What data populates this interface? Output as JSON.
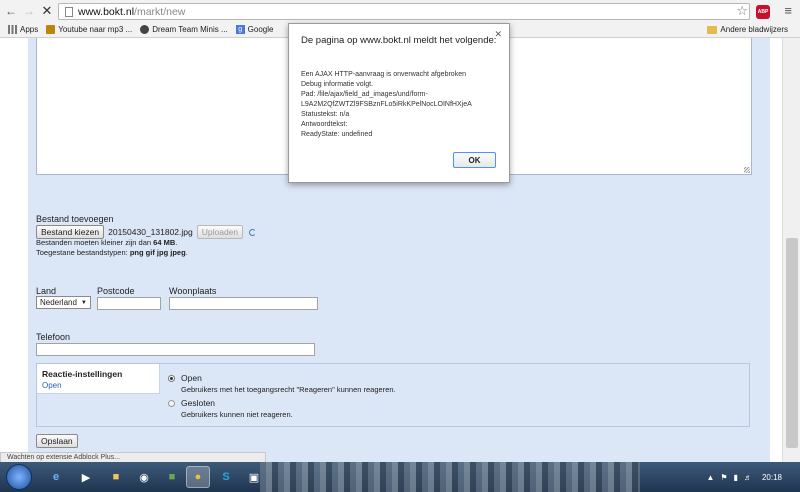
{
  "browser": {
    "url_host": "www.bokt.nl",
    "url_path": "/markt/new",
    "bookmarks": [
      {
        "label": "Apps"
      },
      {
        "label": "Youtube naar mp3 ..."
      },
      {
        "label": "Dream Team Minis ..."
      },
      {
        "label": "Google"
      }
    ],
    "other_bookmarks": "Andere bladwijzers",
    "abp_label": "ABP"
  },
  "form": {
    "file_section_label": "Bestand toevoegen",
    "choose_file_button": "Bestand kiezen",
    "chosen_file_name": "20150430_131802.jpg",
    "upload_button": "Uploaden",
    "size_note_prefix": "Bestanden moeten kleiner zijn dan ",
    "size_note_value": "64 MB",
    "size_note_suffix": ".",
    "types_note_prefix": "Toegestane bestandstypen: ",
    "types_note_value": "png gif jpg jpeg",
    "types_note_suffix": ".",
    "country_label": "Land",
    "country_value": "Nederland",
    "postcode_label": "Postcode",
    "city_label": "Woonplaats",
    "phone_label": "Telefoon",
    "reactions": {
      "heading": "Reactie-instellingen",
      "current": "Open",
      "options": [
        {
          "label": "Open",
          "desc": "Gebruikers met het toegangsrecht \"Reageren\" kunnen reageren.",
          "selected": true
        },
        {
          "label": "Gesloten",
          "desc": "Gebruikers kunnen niet reageren.",
          "selected": false
        }
      ]
    },
    "save_button": "Opslaan"
  },
  "dialog": {
    "title": "De pagina op www.bokt.nl meldt het volgende:",
    "lines": [
      "Een AJAX HTTP-aanvraag is onverwacht afgebroken",
      "Debug informatie volgt.",
      "Pad: /file/ajax/field_ad_images/und/form-",
      "L9A2M2QfZWTZl9FSBznFLo5iRkKPelNocLOINfHXjeA",
      "Statustekst: n/a",
      "Antwoordtekst:",
      "ReadyState: undefined"
    ],
    "ok_button": "OK"
  },
  "status_text": "Wachten op extensie Adblock Plus...",
  "clock": "20:18"
}
